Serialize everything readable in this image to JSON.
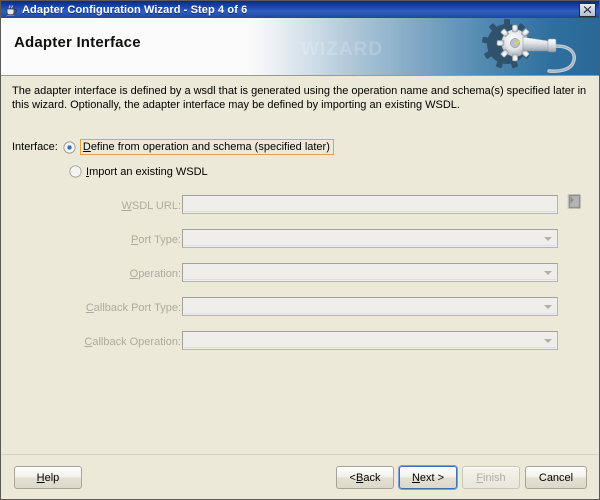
{
  "window": {
    "title": "Adapter Configuration Wizard - Step 4 of 6",
    "icon": "java-coffee-cup-icon",
    "close_label": "✕"
  },
  "banner": {
    "heading": "Adapter Interface",
    "art": "gear-and-cable-icon"
  },
  "content": {
    "description": "The adapter interface is defined by a wsdl that is generated using the operation name and schema(s) specified later in this wizard.  Optionally, the adapter interface may be defined by importing an existing WSDL.",
    "interface_label": "Interface:",
    "options": [
      {
        "id": "define-from-operation",
        "label_mnemonic": "D",
        "label_rest": "efine from operation and schema (specified later)",
        "selected": true,
        "focused": true
      },
      {
        "id": "import-existing-wsdl",
        "label_mnemonic": "I",
        "label_rest": "mport an existing WSDL",
        "selected": false,
        "focused": false
      }
    ],
    "fields": [
      {
        "id": "wsdl-url",
        "mnemonic": "W",
        "label_rest": "SDL URL:",
        "type": "text",
        "value": "",
        "disabled": true,
        "has_browse": true
      },
      {
        "id": "port-type",
        "mnemonic": "P",
        "label_rest": "ort Type:",
        "type": "combo",
        "value": "",
        "disabled": true,
        "has_browse": false
      },
      {
        "id": "operation",
        "mnemonic": "O",
        "label_rest": "peration:",
        "type": "combo",
        "value": "",
        "disabled": true,
        "has_browse": false
      },
      {
        "id": "callback-port-type",
        "mnemonic": "C",
        "label_rest": "allback Port Type:",
        "type": "combo",
        "value": "",
        "disabled": true,
        "has_browse": false
      },
      {
        "id": "callback-operation",
        "mnemonic": "C",
        "label_rest": "allback Operation:",
        "type": "combo",
        "value": "",
        "disabled": true,
        "has_browse": false
      }
    ]
  },
  "buttons": {
    "help": {
      "mnemonic": "H",
      "rest": "elp",
      "disabled": false,
      "focused": false
    },
    "back": {
      "prefix": "< ",
      "mnemonic": "B",
      "rest": "ack",
      "disabled": false,
      "focused": false
    },
    "next": {
      "mnemonic": "N",
      "rest": "ext >",
      "disabled": false,
      "focused": true
    },
    "finish": {
      "mnemonic": "F",
      "rest": "inish",
      "disabled": true,
      "focused": false
    },
    "cancel": {
      "mnemonic": "",
      "rest": "Cancel",
      "disabled": false,
      "focused": false
    }
  },
  "colors": {
    "titlebar_blue": "#1b46a8",
    "dialog_face": "#ece9d8",
    "focus_orange": "#e8a33d",
    "focus_blue": "#3f6fb8",
    "disabled_text": "#adaba0",
    "banner_blue": "#2a6896"
  }
}
